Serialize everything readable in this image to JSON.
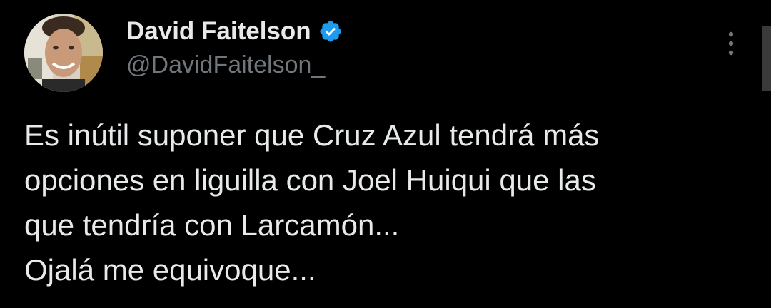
{
  "author": {
    "display_name": "David Faitelson",
    "handle": "@DavidFaitelson_",
    "verified": true,
    "avatar_icon": "profile-photo"
  },
  "tweet": {
    "lines": [
      "Es inútil suponer que Cruz Azul tendrá más",
      "opciones en liguilla con Joel Huiqui que las",
      "que tendría con Larcamón...",
      "Ojalá me equivoque..."
    ]
  },
  "colors": {
    "background": "#000000",
    "text": "#e7e9ea",
    "secondary_text": "#71767b",
    "verified_badge": "#1d9bf0"
  },
  "icons": {
    "verified": "verified-badge-icon",
    "more": "more-options-icon"
  }
}
